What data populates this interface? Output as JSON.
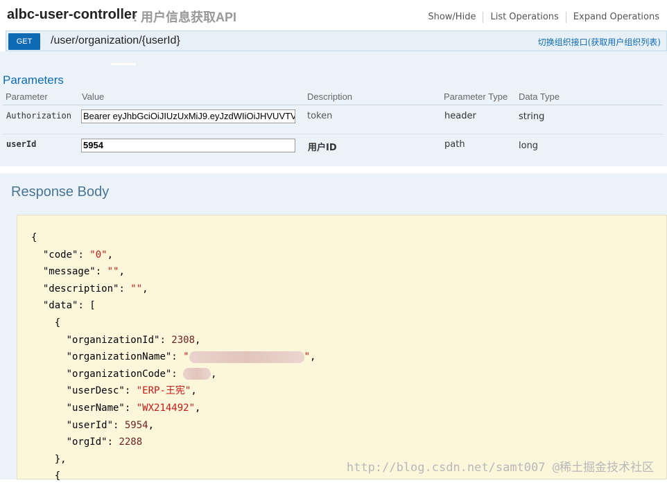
{
  "header": {
    "controller_name": "albc-user-controller",
    "controller_desc": ": 用户信息获取API",
    "links": [
      "Show/Hide",
      "List Operations",
      "Expand Operations"
    ]
  },
  "operation": {
    "method": "GET",
    "path": "/user/organization/{userId}",
    "summary": "切换组织接口(获取用户组织列表)"
  },
  "parameters": {
    "title": "Parameters",
    "columns": [
      "Parameter",
      "Value",
      "Description",
      "Parameter Type",
      "Data Type"
    ],
    "rows": [
      {
        "name": "Authorization",
        "value": "Bearer eyJhbGciOiJIUzUxMiJ9.eyJzdWIiOiJHVUVTV",
        "description": "token",
        "param_type": "header",
        "data_type": "string"
      },
      {
        "name": "userId",
        "value": "5954",
        "description": "用户ID",
        "param_type": "path",
        "data_type": "long"
      }
    ]
  },
  "response": {
    "title": "Response Body",
    "json": {
      "code": "\"0\"",
      "message": "\"\"",
      "description": "\"\"",
      "organizationId": "2308",
      "userDesc": "\"ERP-王宪\"",
      "userName": "\"WX214492\"",
      "userId": "5954",
      "orgId": "2288"
    }
  },
  "watermark": "http://blog.csdn.net/samt007",
  "watermark_site": "@稀土掘金技术社区"
}
